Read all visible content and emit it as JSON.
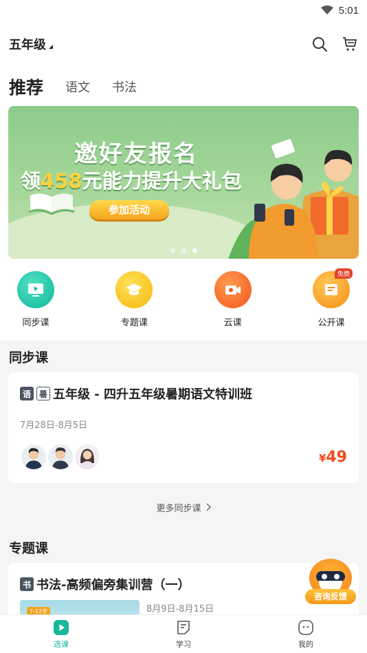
{
  "status": {
    "time": "5:01"
  },
  "header": {
    "grade": "五年级"
  },
  "tabs": [
    {
      "label": "推荐",
      "active": true
    },
    {
      "label": "语文",
      "active": false
    },
    {
      "label": "书法",
      "active": false
    }
  ],
  "banner": {
    "line1": "邀好友报名",
    "line2_prefix": "领",
    "line2_amount": "458",
    "line2_suffix": "元能力提升大礼包",
    "cta": "参加活动",
    "page_index": 3,
    "page_count": 3
  },
  "quick_entries": [
    {
      "label": "同步课",
      "icon": "tv-icon",
      "color": "#13b89a"
    },
    {
      "label": "专题课",
      "icon": "graduation-cap-icon",
      "color": "#f6b80d"
    },
    {
      "label": "云课",
      "icon": "video-camera-icon",
      "color": "#f2571e"
    },
    {
      "label": "公开课",
      "icon": "open-book-icon",
      "color": "#f68d16",
      "badge": "免费"
    }
  ],
  "sync_section": {
    "title": "同步课",
    "course": {
      "tag1": "语",
      "tag2": "暑",
      "title": "五年级 - 四升五年级暑期语文特训班",
      "date": "7月28日-8月5日",
      "price_symbol": "¥",
      "price": "49"
    },
    "more_label": "更多同步课"
  },
  "topic_section": {
    "title": "专题课",
    "course": {
      "tag": "书",
      "title": "书法-高频偏旁集训营（一）",
      "age": "7-12岁",
      "date": "8月9日-8月15日"
    }
  },
  "fab": {
    "label": "咨询反馈"
  },
  "bottom_nav": [
    {
      "label": "选课",
      "active": true
    },
    {
      "label": "学习",
      "active": false
    },
    {
      "label": "我的",
      "active": false
    }
  ],
  "colors": {
    "accent": "#17b899",
    "price": "#ee4c1c"
  }
}
